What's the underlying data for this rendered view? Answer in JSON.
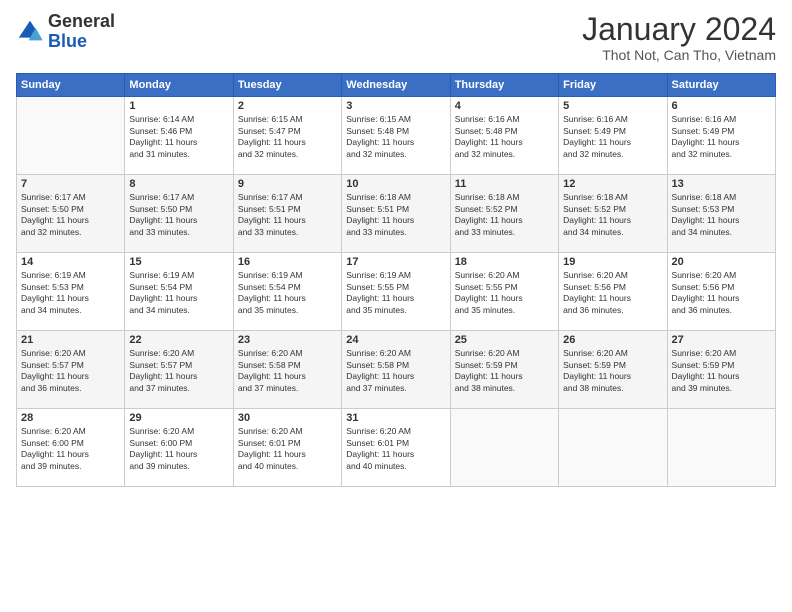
{
  "header": {
    "logo_general": "General",
    "logo_blue": "Blue",
    "month_year": "January 2024",
    "location": "Thot Not, Can Tho, Vietnam"
  },
  "days_of_week": [
    "Sunday",
    "Monday",
    "Tuesday",
    "Wednesday",
    "Thursday",
    "Friday",
    "Saturday"
  ],
  "weeks": [
    [
      {
        "day": "",
        "sunrise": "",
        "sunset": "",
        "daylight": ""
      },
      {
        "day": "1",
        "sunrise": "6:14 AM",
        "sunset": "5:46 PM",
        "daylight": "11 hours and 31 minutes."
      },
      {
        "day": "2",
        "sunrise": "6:15 AM",
        "sunset": "5:47 PM",
        "daylight": "11 hours and 32 minutes."
      },
      {
        "day": "3",
        "sunrise": "6:15 AM",
        "sunset": "5:48 PM",
        "daylight": "11 hours and 32 minutes."
      },
      {
        "day": "4",
        "sunrise": "6:16 AM",
        "sunset": "5:48 PM",
        "daylight": "11 hours and 32 minutes."
      },
      {
        "day": "5",
        "sunrise": "6:16 AM",
        "sunset": "5:49 PM",
        "daylight": "11 hours and 32 minutes."
      },
      {
        "day": "6",
        "sunrise": "6:16 AM",
        "sunset": "5:49 PM",
        "daylight": "11 hours and 32 minutes."
      }
    ],
    [
      {
        "day": "7",
        "sunrise": "6:17 AM",
        "sunset": "5:50 PM",
        "daylight": "11 hours and 32 minutes."
      },
      {
        "day": "8",
        "sunrise": "6:17 AM",
        "sunset": "5:50 PM",
        "daylight": "11 hours and 33 minutes."
      },
      {
        "day": "9",
        "sunrise": "6:17 AM",
        "sunset": "5:51 PM",
        "daylight": "11 hours and 33 minutes."
      },
      {
        "day": "10",
        "sunrise": "6:18 AM",
        "sunset": "5:51 PM",
        "daylight": "11 hours and 33 minutes."
      },
      {
        "day": "11",
        "sunrise": "6:18 AM",
        "sunset": "5:52 PM",
        "daylight": "11 hours and 33 minutes."
      },
      {
        "day": "12",
        "sunrise": "6:18 AM",
        "sunset": "5:52 PM",
        "daylight": "11 hours and 34 minutes."
      },
      {
        "day": "13",
        "sunrise": "6:18 AM",
        "sunset": "5:53 PM",
        "daylight": "11 hours and 34 minutes."
      }
    ],
    [
      {
        "day": "14",
        "sunrise": "6:19 AM",
        "sunset": "5:53 PM",
        "daylight": "11 hours and 34 minutes."
      },
      {
        "day": "15",
        "sunrise": "6:19 AM",
        "sunset": "5:54 PM",
        "daylight": "11 hours and 34 minutes."
      },
      {
        "day": "16",
        "sunrise": "6:19 AM",
        "sunset": "5:54 PM",
        "daylight": "11 hours and 35 minutes."
      },
      {
        "day": "17",
        "sunrise": "6:19 AM",
        "sunset": "5:55 PM",
        "daylight": "11 hours and 35 minutes."
      },
      {
        "day": "18",
        "sunrise": "6:20 AM",
        "sunset": "5:55 PM",
        "daylight": "11 hours and 35 minutes."
      },
      {
        "day": "19",
        "sunrise": "6:20 AM",
        "sunset": "5:56 PM",
        "daylight": "11 hours and 36 minutes."
      },
      {
        "day": "20",
        "sunrise": "6:20 AM",
        "sunset": "5:56 PM",
        "daylight": "11 hours and 36 minutes."
      }
    ],
    [
      {
        "day": "21",
        "sunrise": "6:20 AM",
        "sunset": "5:57 PM",
        "daylight": "11 hours and 36 minutes."
      },
      {
        "day": "22",
        "sunrise": "6:20 AM",
        "sunset": "5:57 PM",
        "daylight": "11 hours and 37 minutes."
      },
      {
        "day": "23",
        "sunrise": "6:20 AM",
        "sunset": "5:58 PM",
        "daylight": "11 hours and 37 minutes."
      },
      {
        "day": "24",
        "sunrise": "6:20 AM",
        "sunset": "5:58 PM",
        "daylight": "11 hours and 37 minutes."
      },
      {
        "day": "25",
        "sunrise": "6:20 AM",
        "sunset": "5:59 PM",
        "daylight": "11 hours and 38 minutes."
      },
      {
        "day": "26",
        "sunrise": "6:20 AM",
        "sunset": "5:59 PM",
        "daylight": "11 hours and 38 minutes."
      },
      {
        "day": "27",
        "sunrise": "6:20 AM",
        "sunset": "5:59 PM",
        "daylight": "11 hours and 39 minutes."
      }
    ],
    [
      {
        "day": "28",
        "sunrise": "6:20 AM",
        "sunset": "6:00 PM",
        "daylight": "11 hours and 39 minutes."
      },
      {
        "day": "29",
        "sunrise": "6:20 AM",
        "sunset": "6:00 PM",
        "daylight": "11 hours and 39 minutes."
      },
      {
        "day": "30",
        "sunrise": "6:20 AM",
        "sunset": "6:01 PM",
        "daylight": "11 hours and 40 minutes."
      },
      {
        "day": "31",
        "sunrise": "6:20 AM",
        "sunset": "6:01 PM",
        "daylight": "11 hours and 40 minutes."
      },
      {
        "day": "",
        "sunrise": "",
        "sunset": "",
        "daylight": ""
      },
      {
        "day": "",
        "sunrise": "",
        "sunset": "",
        "daylight": ""
      },
      {
        "day": "",
        "sunrise": "",
        "sunset": "",
        "daylight": ""
      }
    ]
  ]
}
